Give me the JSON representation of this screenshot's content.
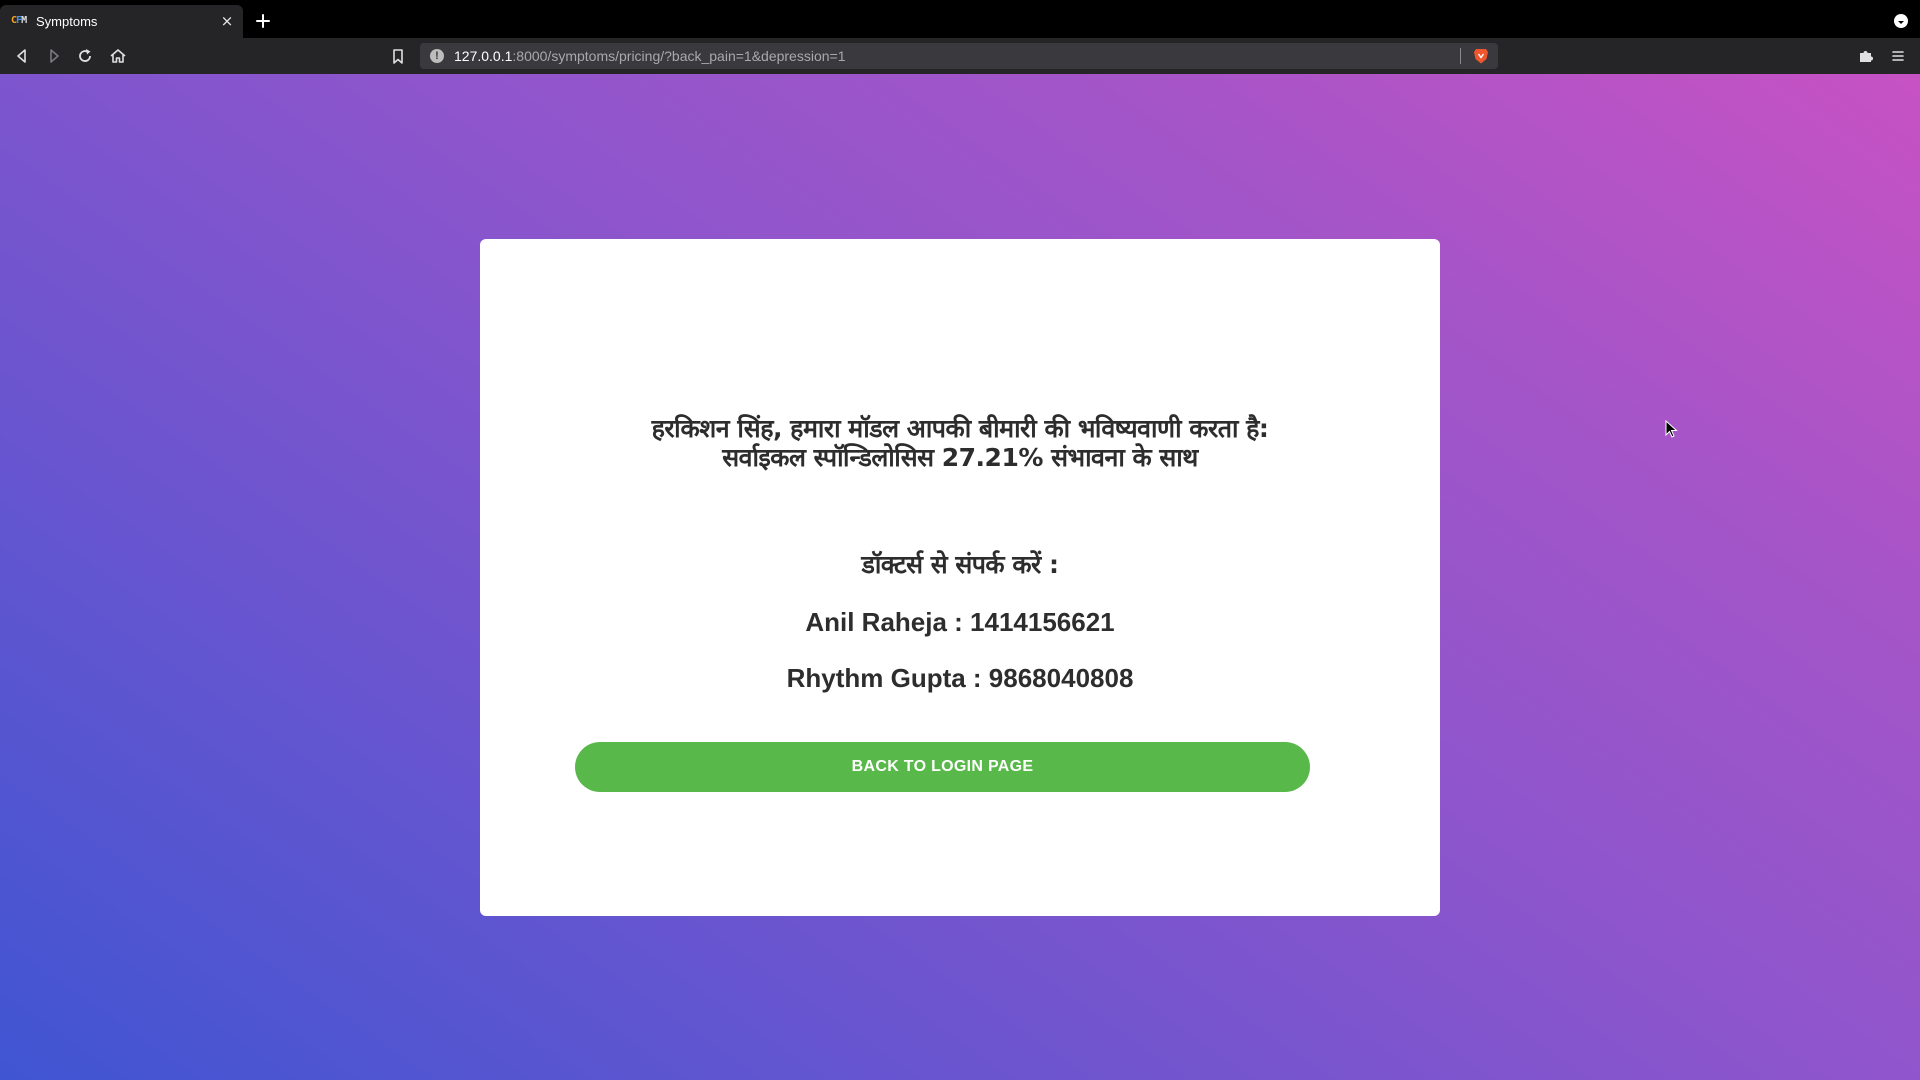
{
  "browser": {
    "tab": {
      "favicon_letters": [
        "C",
        "F",
        "M"
      ],
      "title": "Symptoms"
    },
    "url": {
      "host": "127.0.0.1",
      "path": ":8000/symptoms/pricing/?back_pain=1&depression=1"
    },
    "icons": {
      "tab_close": "×",
      "url_info": "!"
    }
  },
  "page": {
    "prediction_line1": "हरकिशन सिंह, हमारा मॉडल आपकी बीमारी की भविष्यवाणी करता है:",
    "prediction_line2": "सर्वाइकल स्पॉन्डिलोसिस 27.21% संभावना के साथ",
    "contact_heading": "डॉक्टर्स से संपर्क करें :",
    "doctors": [
      {
        "text": "Anil Raheja : 1414156621"
      },
      {
        "text": "Rhythm Gupta : 9868040808"
      }
    ],
    "back_button_label": "BACK TO LOGIN PAGE"
  },
  "colors": {
    "button_green": "#58b94a",
    "gradient_start": "#4055d2",
    "gradient_end": "#c752c4",
    "text_dark": "#2d2d2d"
  }
}
